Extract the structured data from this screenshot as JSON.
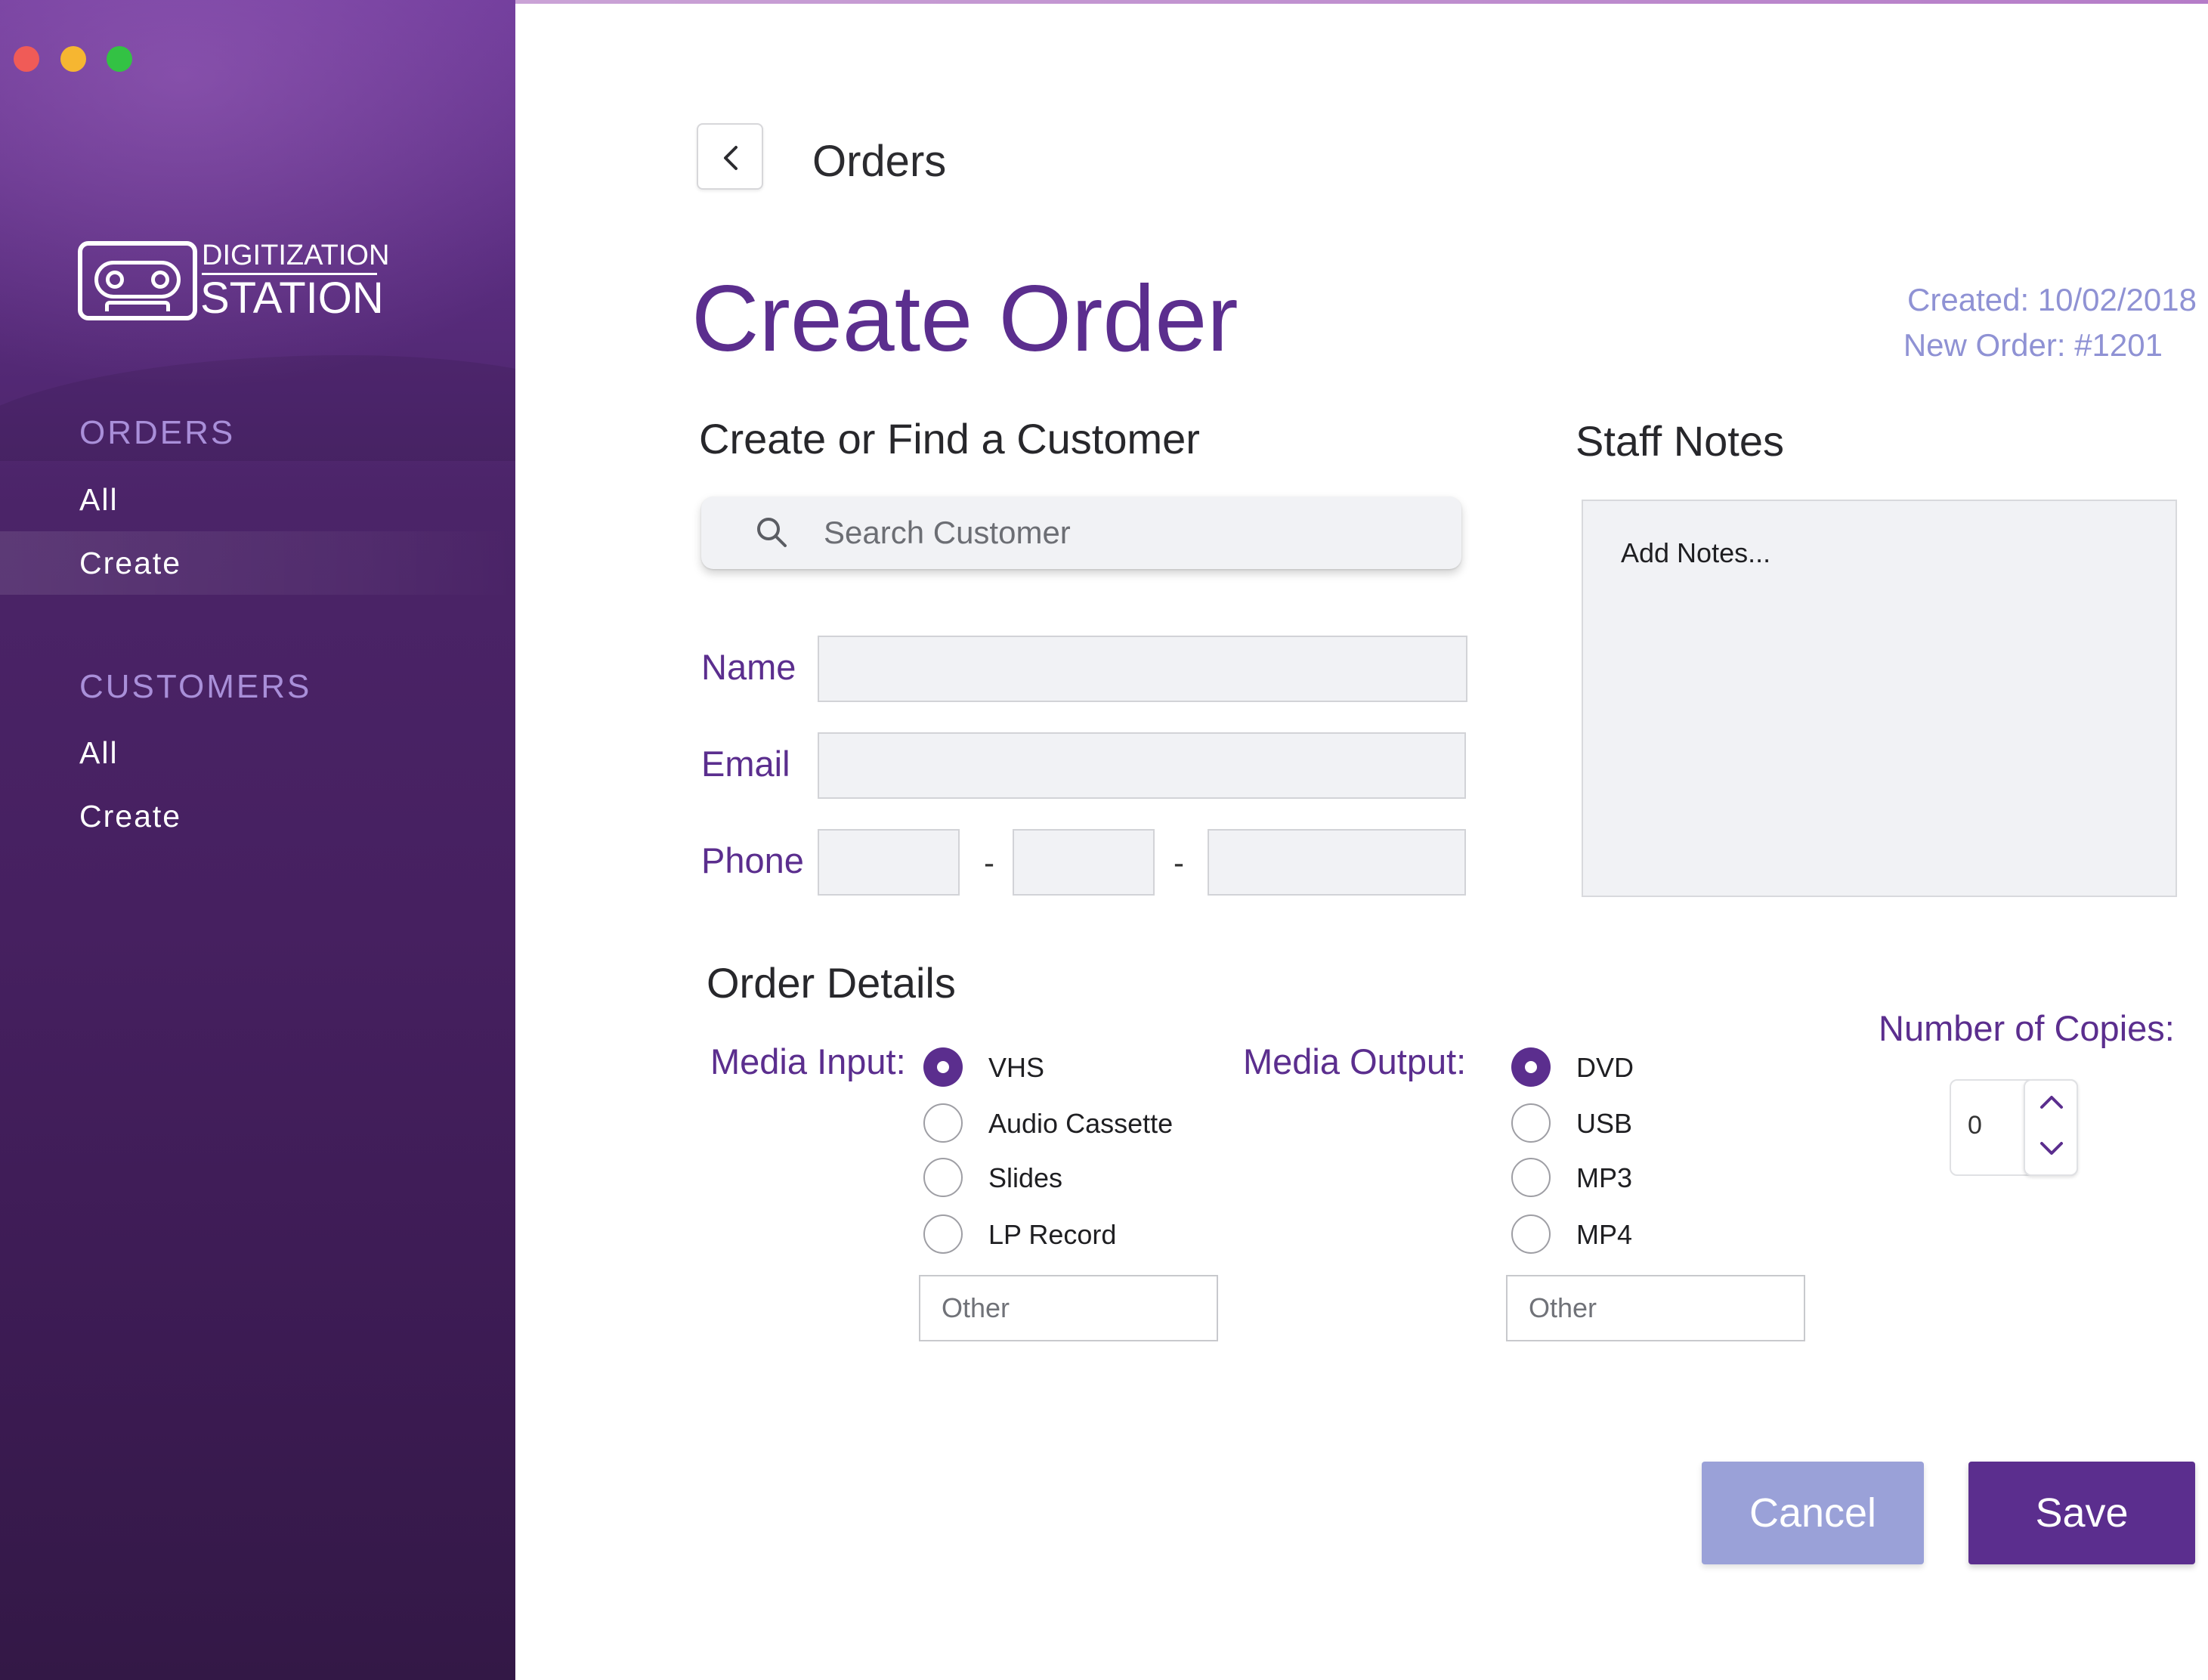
{
  "sidebar": {
    "logo": {
      "top": "DIGITIZATION",
      "bottom": "STATION"
    },
    "sections": [
      {
        "title": "ORDERS",
        "items": [
          {
            "label": "All"
          },
          {
            "label": "Create",
            "active": true
          }
        ]
      },
      {
        "title": "CUSTOMERS",
        "items": [
          {
            "label": "All"
          },
          {
            "label": "Create"
          }
        ]
      }
    ]
  },
  "header": {
    "back_icon": "chevron-left-icon",
    "breadcrumb": "Orders",
    "title": "Create Order",
    "created": "Created: 10/02/2018",
    "order_number": "New Order: #1201"
  },
  "customer": {
    "heading": "Create or Find a Customer",
    "search_icon": "search-icon",
    "search_placeholder": "Search Customer",
    "name_label": "Name",
    "name_value": "",
    "email_label": "Email",
    "email_value": "",
    "phone_label": "Phone",
    "phone_sep": "-",
    "phone_parts": [
      "",
      "",
      ""
    ]
  },
  "notes": {
    "heading": "Staff Notes",
    "placeholder": "Add Notes..."
  },
  "order_details": {
    "heading": "Order Details",
    "media_input": {
      "label": "Media Input:",
      "options": [
        "VHS",
        "Audio Cassette",
        "Slides",
        "LP Record"
      ],
      "selected": "VHS",
      "other_placeholder": "Other"
    },
    "media_output": {
      "label": "Media Output:",
      "options": [
        "DVD",
        "USB",
        "MP3",
        "MP4"
      ],
      "selected": "DVD",
      "other_placeholder": "Other"
    },
    "copies": {
      "label": "Number of Copies:",
      "value": "0"
    }
  },
  "actions": {
    "cancel_label": "Cancel",
    "save_label": "Save"
  },
  "colors": {
    "brand": "#5b2e8e",
    "meta_text": "#8f92d4",
    "cancel_bg": "#9aa1d8",
    "sidebar_top": "#6e3a99",
    "sidebar_bottom": "#331846"
  }
}
